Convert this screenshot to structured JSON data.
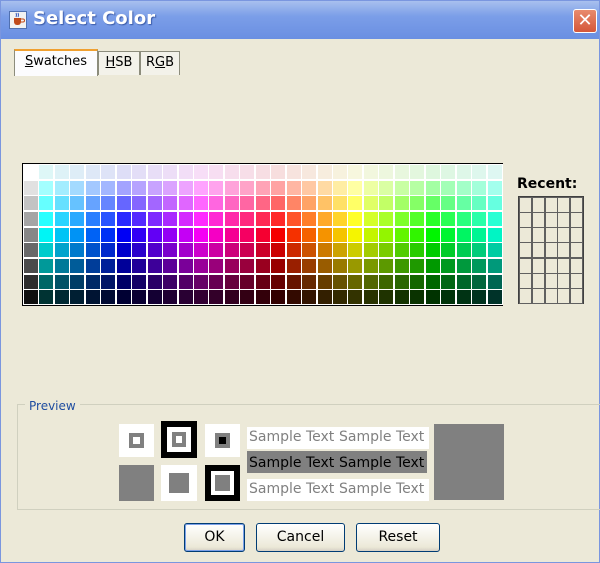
{
  "window": {
    "title": "Select Color"
  },
  "tabs": [
    {
      "label": "Swatches",
      "mnemonic": "S",
      "rest": "watches",
      "active": true
    },
    {
      "label": "HSB",
      "mnemonic": "H",
      "rest": "SB",
      "active": false
    },
    {
      "label": "RGB",
      "prefix": "R",
      "mnemonic": "G",
      "rest": "B",
      "active": false
    }
  ],
  "recent": {
    "label": "Recent:"
  },
  "preview": {
    "label": "Preview",
    "sample_text": "Sample Text",
    "color": "#808080"
  },
  "buttons": {
    "ok": "OK",
    "cancel": "Cancel",
    "reset": "Reset"
  },
  "icons": {
    "app": "java-cup-icon",
    "close": "close-icon"
  },
  "colors": {
    "title_bar": "#7b9ee8",
    "dialog_bg": "#ece9d8",
    "preview_gray": "#808080",
    "label_blue": "#1f4da0"
  }
}
